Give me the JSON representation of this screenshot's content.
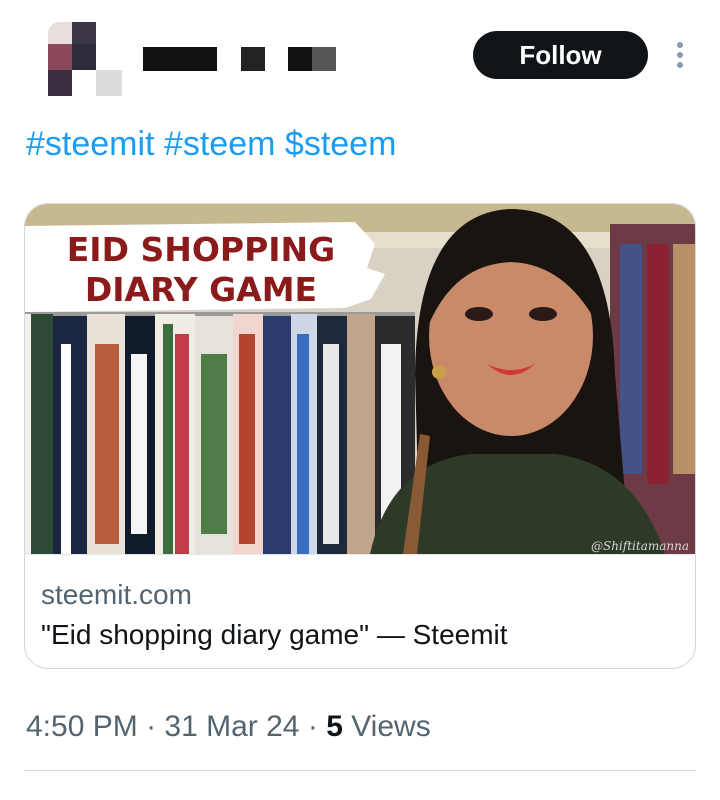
{
  "header": {
    "follow_label": "Follow"
  },
  "tweet": {
    "tags": [
      "#steemit",
      "#steem",
      "$steem"
    ]
  },
  "card": {
    "image": {
      "overlay_line1": "EID SHOPPING",
      "overlay_line2": "DIARY GAME",
      "watermark": "@Shiftitamanna"
    },
    "domain": "steemit.com",
    "title": "\"Eid shopping diary game\" — Steemit"
  },
  "meta": {
    "time": "4:50 PM",
    "separator": "·",
    "date": "31 Mar 24",
    "views_count": "5",
    "views_label": "Views"
  },
  "colors": {
    "link": "#1d9bf0",
    "follow_bg": "#0f1419",
    "secondary_text": "#536471",
    "banner_text": "#8b1a1a"
  },
  "icons": {
    "more": "more-vertical-icon",
    "avatar": "avatar-pixelated"
  }
}
